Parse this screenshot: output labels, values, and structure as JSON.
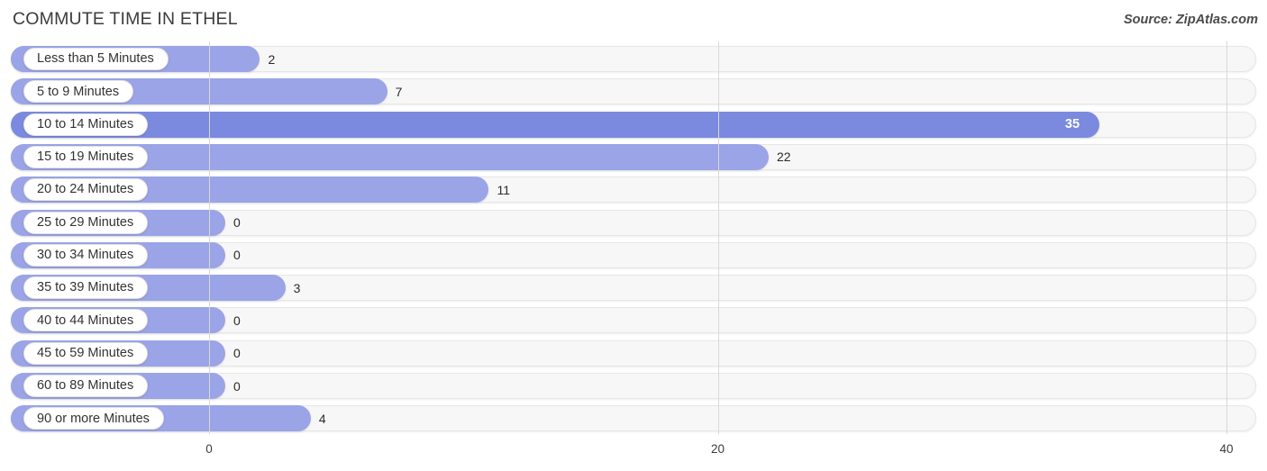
{
  "header": {
    "title": "COMMUTE TIME IN ETHEL",
    "source": "Source: ZipAtlas.com"
  },
  "axis": {
    "ticks": [
      "0",
      "20",
      "40"
    ]
  },
  "chart_data": {
    "type": "bar",
    "orientation": "horizontal",
    "title": "COMMUTE TIME IN ETHEL",
    "subtitle": "",
    "source": "Source: ZipAtlas.com",
    "xlabel": "",
    "ylabel": "",
    "xlim": [
      0,
      40
    ],
    "xticks": [
      0,
      20,
      40
    ],
    "grid": true,
    "legend": false,
    "highlight_category": "10 to 14 Minutes",
    "colors": {
      "bar": "#9aa4e6",
      "bar_highlight": "#7b8ade",
      "track": "#f7f7f7",
      "track_border": "#e6e6e6",
      "pill": "#ffffff",
      "text": "#333333",
      "value_text": "#2b2b2b",
      "value_text_highlight": "#ffffff",
      "gridline": "#d8d8d8",
      "title": "#3c3c3c"
    },
    "categories": [
      "Less than 5 Minutes",
      "5 to 9 Minutes",
      "10 to 14 Minutes",
      "15 to 19 Minutes",
      "20 to 24 Minutes",
      "25 to 29 Minutes",
      "30 to 34 Minutes",
      "35 to 39 Minutes",
      "40 to 44 Minutes",
      "45 to 59 Minutes",
      "60 to 89 Minutes",
      "90 or more Minutes"
    ],
    "values": [
      2,
      7,
      35,
      22,
      11,
      0,
      0,
      3,
      0,
      0,
      0,
      4
    ],
    "value_labels": [
      "2",
      "7",
      "35",
      "22",
      "11",
      "0",
      "0",
      "3",
      "0",
      "0",
      "0",
      "4"
    ]
  }
}
